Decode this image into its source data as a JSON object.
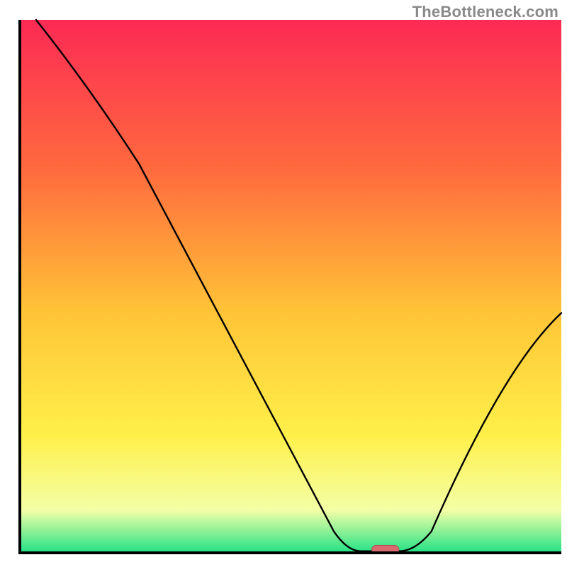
{
  "watermark": {
    "text": "TheBottleneck.com"
  },
  "colors": {
    "gradient_top": "#fc2a55",
    "gradient_mid_upper": "#ff6a3e",
    "gradient_mid": "#ffc437",
    "gradient_mid_lower": "#fff04a",
    "gradient_near_bottom": "#f3ffa6",
    "gradient_bottom": "#22e186",
    "curve": "#000000",
    "axis": "#000000",
    "marker_fill": "#d96a6f",
    "marker_stroke": "#b14a50"
  },
  "chart_data": {
    "type": "line",
    "title": "",
    "xlabel": "",
    "ylabel": "",
    "x_range": [
      0,
      100
    ],
    "y_range": [
      0,
      100
    ],
    "curve": [
      {
        "x": 3,
        "y": 100
      },
      {
        "x": 22,
        "y": 73
      },
      {
        "x": 58,
        "y": 4
      },
      {
        "x": 63,
        "y": 0.3
      },
      {
        "x": 70,
        "y": 0.3
      },
      {
        "x": 76,
        "y": 4
      },
      {
        "x": 100,
        "y": 45
      }
    ],
    "baseline_y": 0,
    "marker": {
      "x_start": 65,
      "x_end": 70,
      "y": 0.6
    },
    "grid": false,
    "legend": null
  }
}
